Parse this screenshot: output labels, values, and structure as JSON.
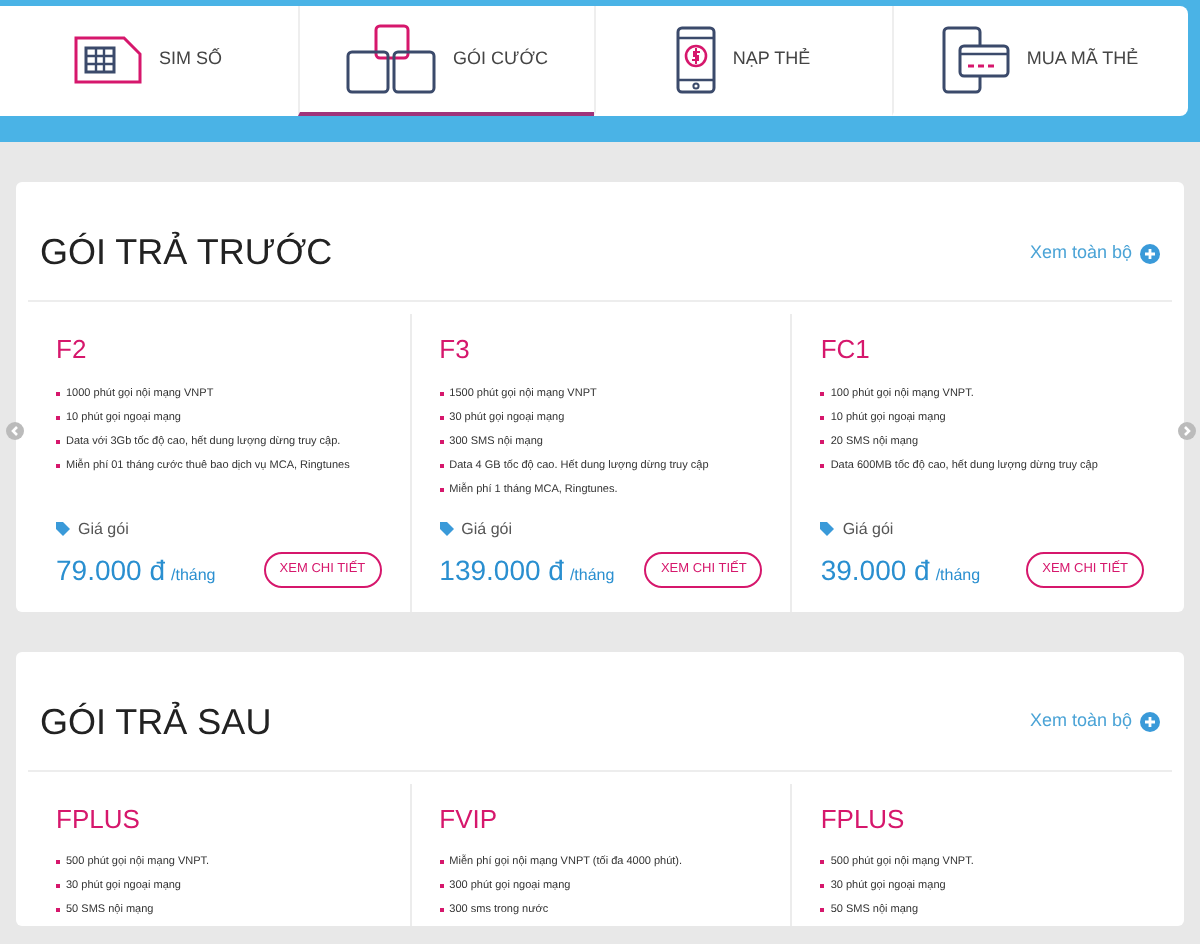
{
  "nav": {
    "tabs": [
      {
        "label": "SIM SỐ",
        "kind": "sim",
        "selected": false
      },
      {
        "label": "GÓI CƯỚC",
        "kind": "boxes",
        "selected": true
      },
      {
        "label": "NẠP THẺ",
        "kind": "phone",
        "selected": false
      },
      {
        "label": "MUA MÃ THẺ",
        "kind": "card",
        "selected": false
      }
    ]
  },
  "sections": [
    {
      "title": "GÓI TRẢ TRƯỚC",
      "link": "Xem toàn bộ",
      "carousel": true,
      "packages": [
        {
          "name": "F2",
          "features": [
            "1000 phút gọi nội mạng VNPT",
            "10 phút gọi ngoại mạng",
            "Data với 3Gb tốc độ cao, hết dung lượng dừng truy cập.",
            "Miễn phí 01 tháng cước thuê bao dịch vụ MCA, Ringtunes"
          ],
          "price_label": "Giá gói",
          "price": "79.000 đ",
          "period": "/tháng",
          "button": "XEM CHI TIẾT"
        },
        {
          "name": "F3",
          "features": [
            "1500 phút gọi nội mạng VNPT",
            "30 phút gọi ngoại mạng",
            "300 SMS nội mạng",
            "Data 4 GB tốc độ cao. Hết dung lượng dừng truy cập",
            "Miễn phí 1 tháng MCA, Ringtunes."
          ],
          "price_label": "Giá gói",
          "price": "139.000 đ",
          "period": "/tháng",
          "button": "XEM CHI TIẾT"
        },
        {
          "name": "FC1",
          "features": [
            "100 phút gọi nội mạng VNPT.",
            "10 phút gọi ngoại mạng",
            "20 SMS nội mạng",
            "Data 600MB tốc độ cao, hết dung lượng dừng truy cập"
          ],
          "price_label": "Giá gói",
          "price": "39.000 đ",
          "period": "/tháng",
          "button": "XEM CHI TIẾT"
        }
      ]
    },
    {
      "title": "GÓI TRẢ SAU",
      "link": "Xem toàn bộ",
      "carousel": false,
      "packages": [
        {
          "name": "FPLUS",
          "features": [
            "500 phút gọi nội mạng VNPT.",
            "30 phút gọi ngoại mạng",
            "50 SMS nội mạng"
          ]
        },
        {
          "name": "FVIP",
          "features": [
            "Miễn phí gọi nội mạng VNPT (tối đa 4000 phút).",
            "300 phút gọi ngoại mạng",
            "300 sms trong nước"
          ]
        },
        {
          "name": "FPLUS",
          "features": [
            "500 phút gọi nội mạng VNPT.",
            "30 phút gọi ngoại mạng",
            "50 SMS nội mạng"
          ]
        }
      ]
    }
  ]
}
